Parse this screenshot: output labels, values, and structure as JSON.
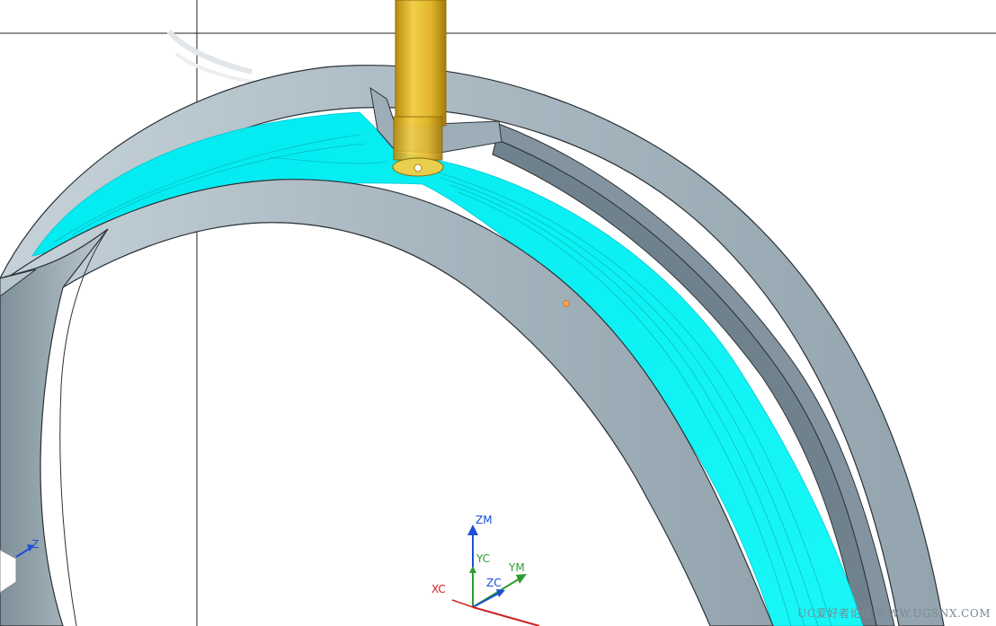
{
  "viewport": {
    "background": "#ffffff",
    "part_color": "#a9b9c2",
    "part_edge": "#2b3136",
    "toolpath_color": "#00f2f2",
    "tool_color": "#e5bc2c"
  },
  "triad": {
    "zm": "ZM",
    "yc": "YC",
    "ym": "YM",
    "zc": "ZC",
    "xc": "XC",
    "colors": {
      "z": "#1a4fd6",
      "y": "#2f9a2f",
      "x": "#d02020"
    }
  },
  "mini_triad": {
    "z": "Z"
  },
  "watermark": {
    "text": "UG爱好者论坛 WWW.UGSNX.COM"
  }
}
